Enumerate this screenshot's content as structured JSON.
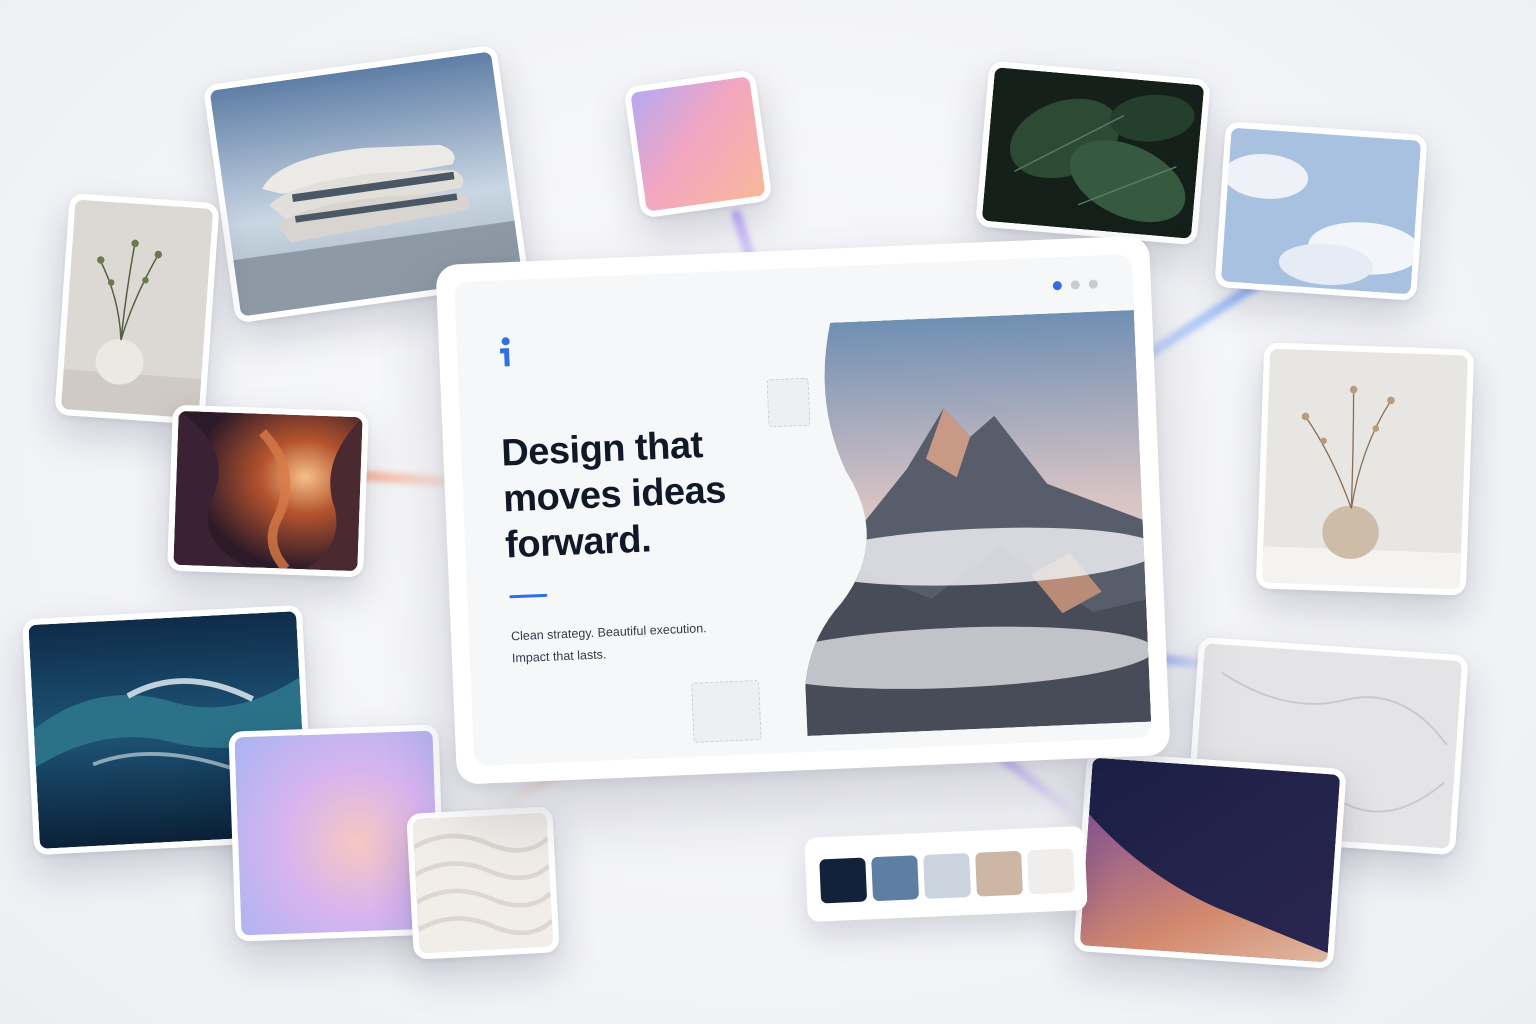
{
  "hero": {
    "headline": "Design that\nmoves ideas\nforward.",
    "subtitle": "Clean strategy. Beautiful execution.\nImpact that lasts."
  },
  "window": {
    "pagination_dots": 3,
    "active_dot": 0
  },
  "colors": {
    "accent": "#2f6fe0",
    "heading": "#111827"
  },
  "palette": {
    "swatches": [
      "#14213a",
      "#5f7ea3",
      "#cad3de",
      "#cdb7a4",
      "#efeeec"
    ]
  },
  "gallery": [
    {
      "name": "architecture-image"
    },
    {
      "name": "vase-plant-image"
    },
    {
      "name": "canyon-image"
    },
    {
      "name": "ocean-wave-image"
    },
    {
      "name": "purple-gradient-image"
    },
    {
      "name": "sand-texture-image"
    },
    {
      "name": "peach-gradient-image"
    },
    {
      "name": "leaves-image"
    },
    {
      "name": "sky-clouds-image"
    },
    {
      "name": "dried-flowers-vase-image"
    },
    {
      "name": "marble-texture-image"
    },
    {
      "name": "abstract-wave-image"
    }
  ]
}
